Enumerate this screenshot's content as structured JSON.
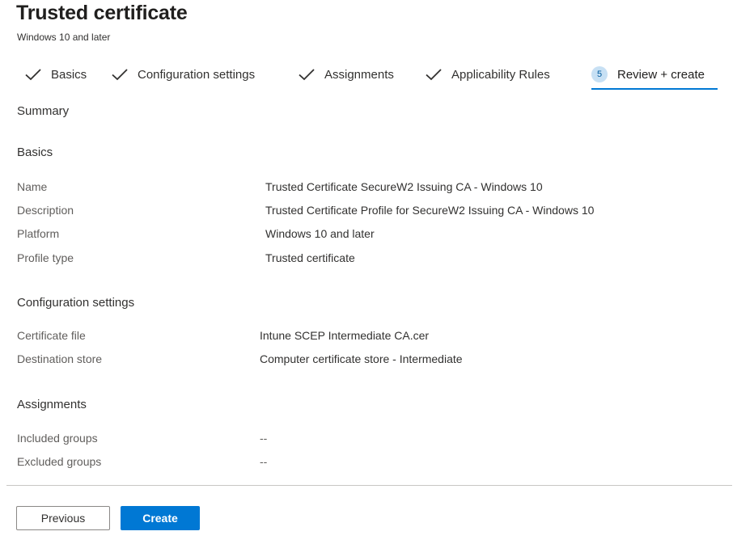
{
  "header": {
    "title": "Trusted certificate",
    "subtitle": "Windows 10 and later"
  },
  "steps": [
    {
      "label": "Basics",
      "state": "completed"
    },
    {
      "label": "Configuration settings",
      "state": "completed"
    },
    {
      "label": "Assignments",
      "state": "completed"
    },
    {
      "label": "Applicability Rules",
      "state": "completed"
    },
    {
      "label": "Review + create",
      "number": "5",
      "state": "active"
    }
  ],
  "summary": {
    "heading": "Summary",
    "basics": {
      "heading": "Basics",
      "rows": [
        {
          "label": "Name",
          "value": "Trusted Certificate SecureW2 Issuing CA - Windows 10"
        },
        {
          "label": "Description",
          "value": "Trusted Certificate Profile for SecureW2 Issuing CA - Windows 10"
        },
        {
          "label": "Platform",
          "value": "Windows 10 and later"
        },
        {
          "label": "Profile type",
          "value": "Trusted certificate"
        }
      ]
    },
    "configuration": {
      "heading": "Configuration settings",
      "rows": [
        {
          "label": "Certificate file",
          "value": "Intune SCEP Intermediate CA.cer"
        },
        {
          "label": "Destination store",
          "value": "Computer certificate store - Intermediate"
        }
      ]
    },
    "assignments": {
      "heading": "Assignments",
      "rows": [
        {
          "label": "Included groups",
          "value": "--"
        },
        {
          "label": "Excluded groups",
          "value": "--"
        }
      ]
    }
  },
  "footer": {
    "previous_label": "Previous",
    "create_label": "Create"
  },
  "colors": {
    "accent": "#0078d4",
    "step_badge": "#c7e0f4",
    "divider": "#c8c6c4"
  }
}
